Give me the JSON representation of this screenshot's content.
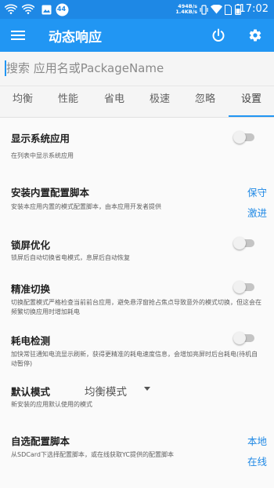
{
  "status_bar": {
    "notification_count": "44",
    "speed_up": "494B/s",
    "speed_down": "1.4KB/s",
    "time": "17:02",
    "icons": [
      "hotspot-icon",
      "hotspot-icon",
      "image-icon",
      "notification-badge-icon",
      "vibrate-icon",
      "wifi-icon",
      "sim-card-icon",
      "battery-icon"
    ]
  },
  "toolbar": {
    "title": "动态响应",
    "icons": [
      "menu-icon",
      "power-icon",
      "gear-icon"
    ]
  },
  "search": {
    "placeholder": "搜索 应用名或PackageName",
    "value": ""
  },
  "tabs": [
    {
      "label": "均衡"
    },
    {
      "label": "性能"
    },
    {
      "label": "省电"
    },
    {
      "label": "极速"
    },
    {
      "label": "忽略"
    },
    {
      "label": "设置"
    }
  ],
  "active_tab": "设置",
  "colors": {
    "primary": "#2196f3",
    "status_bar": "#1e88e5",
    "accent_link": "#1e88e5"
  },
  "settings": {
    "show_system_apps": {
      "title": "显示系统应用",
      "desc": "在列表中显示系统应用",
      "enabled": false
    },
    "install_builtin": {
      "title": "安装内置配置脚本",
      "desc": "安装本应用内置的模式配置脚本，由本应用开发者提供",
      "action1": "保守",
      "action2": "激进"
    },
    "lock_screen": {
      "title": "锁屏优化",
      "desc": "锁屏后自动切换省电模式，息屏后自动恢复",
      "enabled": false
    },
    "precise_switch": {
      "title": "精准切换",
      "desc": "切换配置模式严格检查当前前台应用，避免悬浮窗抢占焦点导致意外的模式切换，但这会在频繁切换应用时增加耗电",
      "enabled": false
    },
    "power_detect": {
      "title": "耗电检测",
      "desc": "加快常驻通知电流显示刷新，获得更精准的耗电速度信息，会增加亮屏时后台耗电(待机自动暂停)",
      "enabled": false
    },
    "default_mode": {
      "title": "默认模式",
      "value": "均衡模式",
      "desc": "新安装的应用默认使用的模式"
    },
    "custom_script": {
      "title": "自选配置脚本",
      "desc": "从SDCard下选择配置脚本，或在线获取YC提供的配置脚本",
      "action1": "本地",
      "action2": "在线"
    }
  }
}
